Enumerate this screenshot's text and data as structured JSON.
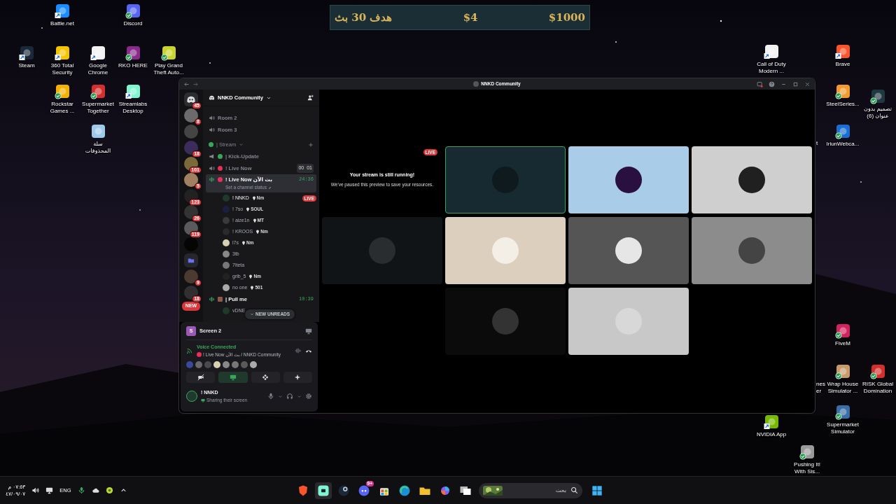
{
  "goal_widget": {
    "caption": "هدف 30 بث",
    "current": "$4",
    "target": "$1000"
  },
  "desktop_icons": [
    {
      "label": "Battle.net",
      "kind": "shortcut"
    },
    {
      "label": "Discord",
      "kind": "synced"
    },
    {
      "label": "Steam",
      "kind": "shortcut"
    },
    {
      "label": "360 Total Security",
      "kind": "shortcut"
    },
    {
      "label": "Google Chrome",
      "kind": "shortcut"
    },
    {
      "label": "RKO HERE",
      "kind": "synced"
    },
    {
      "label": "Play Grand Theft Auto...",
      "kind": "synced"
    },
    {
      "label": "Rockstar Games ...",
      "kind": "synced"
    },
    {
      "label": "Supermarket Together",
      "kind": "synced"
    },
    {
      "label": "Streamlabs Desktop",
      "kind": "shortcut"
    },
    {
      "label": "سلة المحذوفات",
      "kind": "plain"
    },
    {
      "label": "Call of Duty Modern ...",
      "kind": "shortcut"
    },
    {
      "label": "Brave",
      "kind": "shortcut"
    },
    {
      "label": "SteelSeries...",
      "kind": "synced"
    },
    {
      "label": "تصميم بدون عنوان (6)",
      "kind": "synced"
    },
    {
      "label": "t",
      "kind": "covered"
    },
    {
      "label": "IriunWebca...",
      "kind": "synced"
    },
    {
      "label": "FiveM",
      "kind": "synced"
    },
    {
      "label": "nes",
      "kind": "covered"
    },
    {
      "label": "er",
      "kind": "covered"
    },
    {
      "label": "Wrap House Simulator ...",
      "kind": "synced"
    },
    {
      "label": "RISK Global Domination",
      "kind": "synced"
    },
    {
      "label": "NVIDIA App",
      "kind": "shortcut"
    },
    {
      "label": "Supermarket Simulator",
      "kind": "synced"
    },
    {
      "label": "Pushing It! With Sis...",
      "kind": "synced"
    }
  ],
  "discord": {
    "title": "NNKD Community",
    "servers": [
      {
        "kind": "home",
        "badge": "45"
      },
      {
        "kind": "server",
        "badge": "8"
      },
      {
        "kind": "server"
      },
      {
        "kind": "server",
        "badge": "18"
      },
      {
        "kind": "server",
        "badge": "101"
      },
      {
        "kind": "server",
        "badge": "5"
      },
      {
        "kind": "server",
        "badge": "123"
      },
      {
        "kind": "server",
        "badge": "26"
      },
      {
        "kind": "server",
        "badge": "119"
      },
      {
        "kind": "server"
      },
      {
        "kind": "folder"
      },
      {
        "kind": "server",
        "badge": "9"
      },
      {
        "kind": "server",
        "badge": "18"
      }
    ],
    "new_pill": "NEW",
    "server_name": "NNKD Community",
    "channels": [
      {
        "kind": "voice",
        "name": "Room 2",
        "selected": false,
        "connected": false
      },
      {
        "kind": "voice",
        "name": "Room 3",
        "selected": false,
        "connected": false
      },
      {
        "kind": "category",
        "name": "| Stream",
        "color": "#3ba55d"
      },
      {
        "kind": "announcement",
        "name": "| Kick-Update",
        "color": "#3ba55d",
        "selected": false
      },
      {
        "kind": "voice",
        "name": "! Live Now",
        "color": "#e8305a",
        "selected": false,
        "connected": false,
        "counts": [
          "00",
          "01"
        ]
      },
      {
        "kind": "voice",
        "name": "! Live Now بث الآن",
        "color": "#e8305a",
        "selected": true,
        "connected": true,
        "time": "24:36",
        "status": "Set a channel status",
        "members": [
          {
            "name": "! NNKD",
            "tag": "Nm",
            "live_badge": "LIVE"
          },
          {
            "name": "! 7so",
            "tag": "SOUL"
          },
          {
            "name": "! aize1n",
            "tag": "MT"
          },
          {
            "name": "! KROOS",
            "tag": "Nm"
          },
          {
            "name": "l7s",
            "tag": "Nm"
          },
          {
            "name": "3tb"
          },
          {
            "name": "7iteta"
          },
          {
            "name": "grib_5",
            "tag": "Nm"
          },
          {
            "name": "no one",
            "tag": "501"
          }
        ]
      },
      {
        "kind": "voice",
        "name": "| Pull me",
        "color": "#8b5a4a",
        "selected": false,
        "connected": true,
        "time": "10:39",
        "members": [
          {
            "name": "vDNE"
          }
        ]
      }
    ],
    "new_unreads": "NEW UNREADS",
    "panel": {
      "stream_avatar": "S",
      "stream_title": "Screen 2",
      "status": "Voice Connected",
      "location": "! Live Now بث الآن / NNKD Community",
      "controls": [
        {
          "kind": "camera",
          "selected": false
        },
        {
          "kind": "screen",
          "selected": true
        },
        {
          "kind": "activity",
          "selected": false
        },
        {
          "kind": "soundboard",
          "selected": false
        }
      ],
      "user": {
        "name": "! NNKD",
        "activity": "Sharing their screen"
      }
    },
    "stage": {
      "live_badge": "LIVE",
      "paused_title": "Your stream is still running!",
      "paused_text": "We've paused this preview to save your resources.",
      "tiles": [
        {
          "kind": "preview"
        },
        {
          "kind": "avatar",
          "color": "#172a31",
          "speaking": true
        },
        {
          "kind": "avatar",
          "color": "#a9cde8",
          "speaking": false
        },
        {
          "kind": "avatar",
          "color": "#cfcfcf",
          "speaking": false
        },
        {
          "kind": "avatar",
          "color": "#111417",
          "speaking": false
        },
        {
          "kind": "avatar",
          "color": "#dccfbd",
          "speaking": false
        },
        {
          "kind": "avatar",
          "color": "#555555",
          "speaking": false
        },
        {
          "kind": "avatar",
          "color": "#8c8c8c",
          "speaking": false
        },
        {
          "kind": "avatar",
          "color": "#0b0b0b",
          "speaking": false
        },
        {
          "kind": "avatar",
          "color": "#c8c8c8",
          "speaking": false
        }
      ]
    }
  },
  "taskbar": {
    "time": "٠٧:٥٣ م",
    "date": "٤٧/٠٩/٠٧",
    "language": "ENG",
    "apps": [
      {
        "kind": "brave",
        "selected": false
      },
      {
        "kind": "streamlabs",
        "selected": true
      },
      {
        "kind": "steam",
        "selected": false
      },
      {
        "kind": "discord",
        "selected": false,
        "badge": "9+"
      },
      {
        "kind": "store",
        "selected": false
      },
      {
        "kind": "edge",
        "selected": false
      },
      {
        "kind": "explorer",
        "selected": false
      },
      {
        "kind": "m365",
        "selected": false
      },
      {
        "kind": "taskview",
        "selected": false
      }
    ],
    "search": {
      "placeholder": "بحث"
    }
  }
}
